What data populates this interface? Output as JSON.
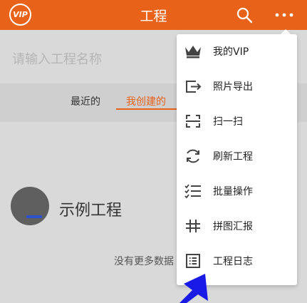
{
  "header": {
    "vip_badge": "VIP",
    "title": "工程"
  },
  "search": {
    "placeholder": "请输入工程名称"
  },
  "tabs": [
    {
      "label": "最近的"
    },
    {
      "label": "我创建的"
    }
  ],
  "projects": [
    {
      "name": "示例工程"
    }
  ],
  "list_footer": "没有更多数据",
  "menu": {
    "items": [
      {
        "label": "我的VIP",
        "icon": "crown-icon"
      },
      {
        "label": "照片导出",
        "icon": "export-icon"
      },
      {
        "label": "扫一扫",
        "icon": "scan-icon"
      },
      {
        "label": "刷新工程",
        "icon": "refresh-icon"
      },
      {
        "label": "批量操作",
        "icon": "checklist-icon"
      },
      {
        "label": "拼图汇报",
        "icon": "hashtag-icon"
      },
      {
        "label": "工程日志",
        "icon": "log-icon"
      }
    ]
  },
  "colors": {
    "brand": "#e8621a",
    "pointer": "#1a1ae6"
  }
}
